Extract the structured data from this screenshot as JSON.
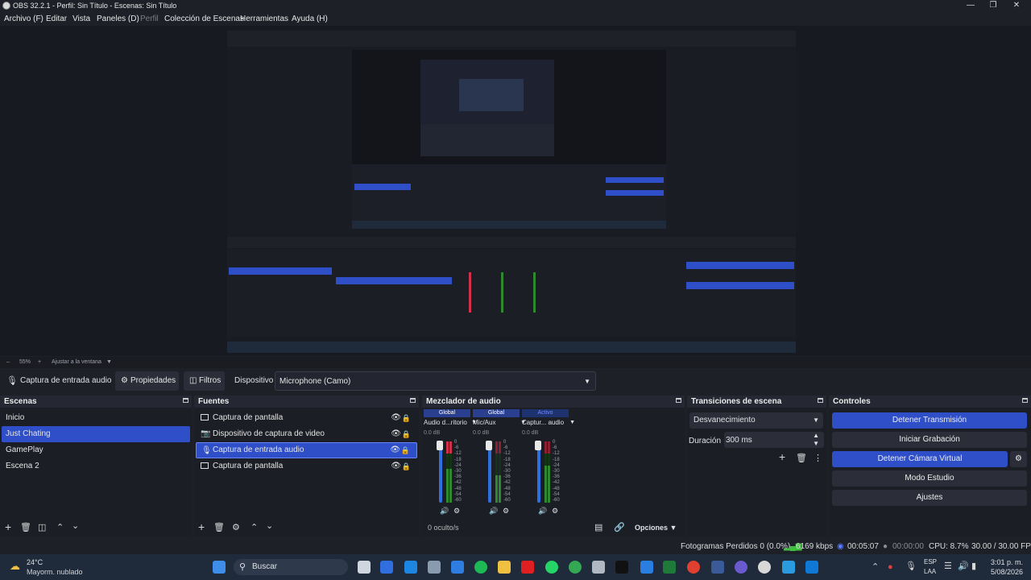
{
  "window": {
    "title": "OBS 32.2.1 - Perfil: Sin Título - Escenas: Sin Título"
  },
  "menu": {
    "archivo": "Archivo (F)",
    "editar": "Editar",
    "vista": "Vista",
    "paneles": "Paneles (D)",
    "perfil": "Perfil",
    "coleccion": "Colección de Escenas",
    "herramientas": "Herramientas",
    "ayuda": "Ayuda (H)"
  },
  "zoom": {
    "value": "55%",
    "fit_label": "Ajustar a la ventana"
  },
  "source_toolbar": {
    "source_name": "Captura de entrada audio",
    "properties_label": "Propiedades",
    "filters_label": "Filtros",
    "device_label": "Dispositivo",
    "device_value": "Microphone (Camo)"
  },
  "scenes": {
    "title": "Escenas",
    "items": [
      "Inicio",
      "Just Chating",
      "GamePlay",
      "Escena 2"
    ],
    "selected_index": 1
  },
  "sources": {
    "title": "Fuentes",
    "items": [
      {
        "label": "Captura de pantalla",
        "icon": "monitor-icon"
      },
      {
        "label": "Dispositivo de captura de video",
        "icon": "camera-icon"
      },
      {
        "label": "Captura de entrada audio",
        "icon": "microphone-icon"
      },
      {
        "label": "Captura de pantalla",
        "icon": "monitor-icon"
      }
    ],
    "selected_index": 2
  },
  "mixer": {
    "title": "Mezclador de audio",
    "channels": [
      {
        "tag": "Global",
        "name": "Audio d...ritorio",
        "db": "0.0 dB",
        "level_fraction": 0.55,
        "active": false
      },
      {
        "tag": "Global",
        "name": "Mic/Aux",
        "db": "0.0 dB",
        "level_fraction": 0.45,
        "active": false
      },
      {
        "tag": "Activo",
        "name": "Captur... audio",
        "db": "0.0 dB",
        "level_fraction": 0.6,
        "active": true
      }
    ],
    "scale": [
      "0",
      "-6",
      "-12",
      "-18",
      "-24",
      "-30",
      "-36",
      "-42",
      "-48",
      "-54",
      "-60"
    ],
    "hidden_label": "0 oculto/s",
    "options_label": "Opciones"
  },
  "transitions": {
    "title": "Transiciones de escena",
    "selected": "Desvanecimiento",
    "duration_label": "Duración",
    "duration_value": "300 ms"
  },
  "controls": {
    "title": "Controles",
    "stop_stream": "Detener Transmisión",
    "start_record": "Iniciar Grabación",
    "stop_virtualcam": "Detener Cámara Virtual",
    "studio_mode": "Modo Estudio",
    "settings": "Ajustes"
  },
  "status": {
    "dropped_frames": "Fotogramas Perdidos 0 (0.0%)",
    "bitrate": "6169 kbps",
    "stream_time": "00:05:07",
    "record_time": "00:00:00",
    "cpu": "CPU: 8.7%",
    "fps": "30.00 / 30.00 FPS"
  },
  "taskbar": {
    "weather_temp": "24°C",
    "weather_desc": "Mayorm. nublado",
    "search_placeholder": "Buscar",
    "lang_top": "ESP",
    "lang_bottom": "LAA",
    "time": "3:01 p. m.",
    "date": "5/08/2026"
  },
  "colors": {
    "accent": "#2f4fc8",
    "panel_bg": "#1c1e25",
    "header_bg": "#252833",
    "live_green": "#3fbf3f",
    "meter_red": "#d0304a"
  }
}
